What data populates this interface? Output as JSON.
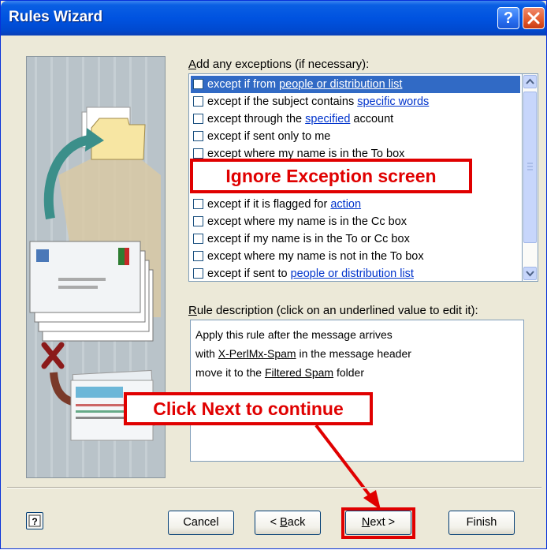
{
  "window": {
    "title": "Rules Wizard",
    "help_glyph": "?",
    "close_icon": "close-icon"
  },
  "exceptions": {
    "label_prefix": "A",
    "label_rest": "dd any exceptions (if necessary):",
    "items": [
      {
        "before": "except if from ",
        "link": "people or distribution list",
        "after": "",
        "selected": true,
        "checked": false
      },
      {
        "before": "except if the subject contains ",
        "link": "specific words",
        "after": "",
        "selected": false,
        "checked": false
      },
      {
        "before": "except through the ",
        "link": "specified",
        "after": " account",
        "selected": false,
        "checked": false
      },
      {
        "before": "except if sent only to me",
        "link": "",
        "after": "",
        "selected": false,
        "checked": false
      },
      {
        "before": "except where my name is in the To box",
        "link": "",
        "after": "",
        "selected": false,
        "checked": false
      },
      {
        "before": "except if it is flagged for ",
        "link": "action",
        "after": "",
        "selected": false,
        "checked": false
      },
      {
        "before": "except where my name is in the Cc box",
        "link": "",
        "after": "",
        "selected": false,
        "checked": false
      },
      {
        "before": "except if my name is in the To or Cc box",
        "link": "",
        "after": "",
        "selected": false,
        "checked": false
      },
      {
        "before": "except where my name is not in the To box",
        "link": "",
        "after": "",
        "selected": false,
        "checked": false
      },
      {
        "before": "except if sent to ",
        "link": "people or distribution list",
        "after": "",
        "selected": false,
        "checked": false
      }
    ]
  },
  "annotations": {
    "ignore": "Ignore Exception screen",
    "next": "Click Next to continue",
    "color": "#e00000"
  },
  "description": {
    "label_prefix": "R",
    "label_rest": "ule description (click on an underlined value to edit it):",
    "line1": "Apply this rule after the message arrives",
    "line2_before": "with ",
    "line2_link": "X-PerlMx-Spam",
    "line2_after": " in the message header",
    "line3_before": "move it to the ",
    "line3_link": "Filtered Spam",
    "line3_after": " folder"
  },
  "buttons": {
    "cancel": "Cancel",
    "back_prefix": "< ",
    "back_ul": "B",
    "back_rest": "ack",
    "next_ul": "N",
    "next_rest": "ext >",
    "finish": "Finish"
  }
}
